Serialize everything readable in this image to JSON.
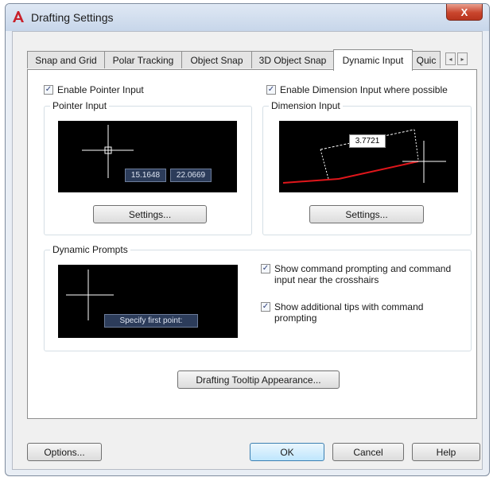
{
  "window": {
    "title": "Drafting Settings",
    "close_glyph": "X"
  },
  "tabs": [
    {
      "label": "Snap and Grid"
    },
    {
      "label": "Polar Tracking"
    },
    {
      "label": "Object Snap"
    },
    {
      "label": "3D Object Snap"
    },
    {
      "label": "Dynamic Input",
      "active": true
    },
    {
      "label": "Quic"
    }
  ],
  "tab_scroll": {
    "left": "◂",
    "right": "▸"
  },
  "pointer": {
    "enable_label": "Enable Pointer Input",
    "enabled": true,
    "group_label": "Pointer Input",
    "x_value": "15.1648",
    "y_value": "22.0669",
    "settings_label": "Settings..."
  },
  "dimension": {
    "enable_label": "Enable Dimension Input where possible",
    "enabled": true,
    "group_label": "Dimension Input",
    "value": "3.7721",
    "settings_label": "Settings..."
  },
  "prompts": {
    "group_label": "Dynamic Prompts",
    "preview_text": "Specify first point:",
    "show_prompting_label": "Show command prompting and command input near the crosshairs",
    "show_prompting": true,
    "additional_tips_label": "Show additional tips with command prompting",
    "additional_tips": true
  },
  "tooltip_button_label": "Drafting Tooltip Appearance...",
  "footer": {
    "options": "Options...",
    "ok": "OK",
    "cancel": "Cancel",
    "help": "Help"
  },
  "colors": {
    "check": "#2d3e78",
    "dimension_line": "#e0161b",
    "preview_bg": "#000000"
  },
  "check_glyph": "✓"
}
